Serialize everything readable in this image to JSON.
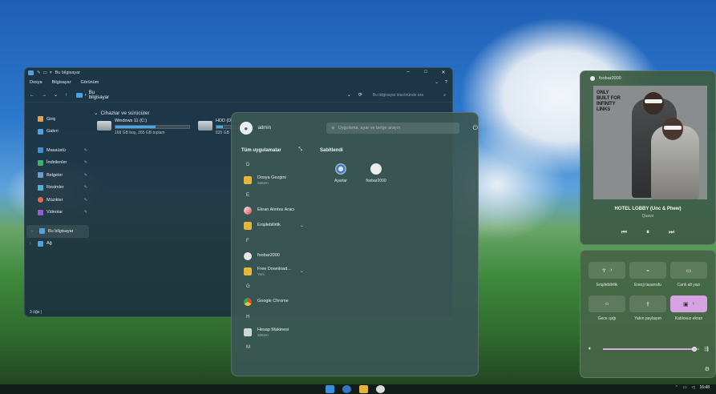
{
  "explorer": {
    "title": "Bu bilgisayar",
    "menu": [
      "Dosya",
      "Bilgisayar",
      "Görünüm"
    ],
    "address": "Bu bilgisayar",
    "search_placeholder": "Bu bilgisayar klasöründe ara",
    "sidebar": [
      {
        "label": "Giriş",
        "icon": "home-icon",
        "color": "#e0a24a"
      },
      {
        "label": "Galeri",
        "icon": "gallery-icon",
        "color": "#4aa3e6"
      },
      {
        "label": "Masaüstü",
        "icon": "desktop-icon",
        "color": "#3f8fd8",
        "pinned": true
      },
      {
        "label": "İndirilenler",
        "icon": "downloads-icon",
        "color": "#3db36b",
        "pinned": true
      },
      {
        "label": "Belgeler",
        "icon": "documents-icon",
        "color": "#6f9ad8",
        "pinned": true
      },
      {
        "label": "Resimler",
        "icon": "pictures-icon",
        "color": "#4fb0d8",
        "pinned": true
      },
      {
        "label": "Müzikler",
        "icon": "music-icon",
        "color": "#e56a4a",
        "pinned": true
      },
      {
        "label": "Videolar",
        "icon": "videos-icon",
        "color": "#9a5ad8",
        "pinned": true
      },
      {
        "label": "Bu bilgisayar",
        "icon": "this-pc-icon",
        "color": "#4aa3e6",
        "selected": true
      },
      {
        "label": "Ağ",
        "icon": "network-icon",
        "color": "#4aa3e6"
      }
    ],
    "group_title": "Cihazlar ve sürücüler",
    "drives": [
      {
        "name": "Windows 11 (C:)",
        "size": "168 GB boş, 365 GB toplam",
        "used_fraction": 0.54
      },
      {
        "name": "HDD (D:)",
        "size": "825 GB",
        "used_fraction": 0.2
      }
    ],
    "status": "3 öğe"
  },
  "start": {
    "user": "admin",
    "search_placeholder": "Uygulama, ayar ve belge arayın",
    "all_apps_label": "Tüm uygulamalar",
    "pinned_label": "Sabitlendi",
    "letters": {
      "d": "D",
      "e": "E",
      "f": "F",
      "g": "G",
      "h": "H",
      "m": "M"
    },
    "apps": {
      "explorer": {
        "name": "Dosya Gezgini",
        "sub": "Sistem"
      },
      "snipping": {
        "name": "Ekran Alıntısı Aracı"
      },
      "accessibility": {
        "name": "Erişilebilirlik"
      },
      "foobar": {
        "name": "foobar2000"
      },
      "fdm": {
        "name": "Free Download...",
        "sub": "Yeni"
      },
      "chrome": {
        "name": "Google Chrome"
      },
      "calculator": {
        "name": "Hesap Makinesi",
        "sub": "Sistem"
      }
    },
    "pinned": [
      {
        "label": "Ayarlar",
        "icon": "settings-icon"
      },
      {
        "label": "foobar2000",
        "icon": "foobar-icon"
      }
    ]
  },
  "media": {
    "app": "foobar2000",
    "album_text": "ONLY BUILT FOR INFINITY LINKS",
    "track": "HOTEL LOBBY (Unc & Phew)",
    "artist": "Quavo"
  },
  "quick": {
    "tiles": [
      {
        "label": "Erişilebilirlik",
        "icon": "accessibility-icon",
        "on": false,
        "has_menu": true
      },
      {
        "label": "Enerji tasarrufu",
        "icon": "battery-saver-icon",
        "on": false
      },
      {
        "label": "Canlı alt yazı",
        "icon": "live-captions-icon",
        "on": false
      },
      {
        "label": "Gece ışığı",
        "icon": "night-light-icon",
        "on": false
      },
      {
        "label": "Yakın paylaşım",
        "icon": "nearby-share-icon",
        "on": false
      },
      {
        "label": "Kablosuz ekran",
        "icon": "cast-icon",
        "on": true,
        "has_menu": true
      }
    ],
    "volume_fraction": 0.95
  },
  "taskbar": {
    "time": "16:48",
    "apps": [
      "start-icon",
      "edge-icon",
      "file-explorer-icon",
      "foobar-icon"
    ],
    "app_colors": [
      "#3a8fe0",
      "#2f78c8",
      "#e6b53c",
      "#dcdcdc"
    ]
  },
  "colors": {
    "accent": "#4fa6e4",
    "toggle_on": "#d6a3e2"
  }
}
